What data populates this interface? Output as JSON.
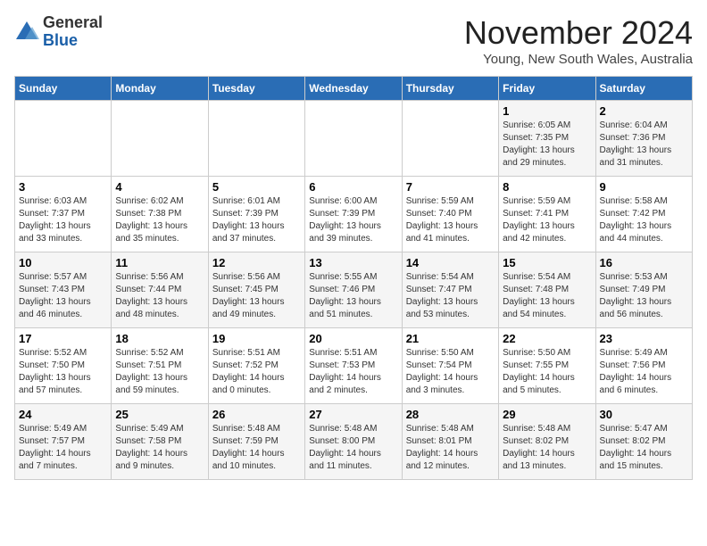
{
  "logo": {
    "general": "General",
    "blue": "Blue"
  },
  "title": "November 2024",
  "location": "Young, New South Wales, Australia",
  "weekdays": [
    "Sunday",
    "Monday",
    "Tuesday",
    "Wednesday",
    "Thursday",
    "Friday",
    "Saturday"
  ],
  "weeks": [
    [
      {
        "day": "",
        "info": ""
      },
      {
        "day": "",
        "info": ""
      },
      {
        "day": "",
        "info": ""
      },
      {
        "day": "",
        "info": ""
      },
      {
        "day": "",
        "info": ""
      },
      {
        "day": "1",
        "info": "Sunrise: 6:05 AM\nSunset: 7:35 PM\nDaylight: 13 hours\nand 29 minutes."
      },
      {
        "day": "2",
        "info": "Sunrise: 6:04 AM\nSunset: 7:36 PM\nDaylight: 13 hours\nand 31 minutes."
      }
    ],
    [
      {
        "day": "3",
        "info": "Sunrise: 6:03 AM\nSunset: 7:37 PM\nDaylight: 13 hours\nand 33 minutes."
      },
      {
        "day": "4",
        "info": "Sunrise: 6:02 AM\nSunset: 7:38 PM\nDaylight: 13 hours\nand 35 minutes."
      },
      {
        "day": "5",
        "info": "Sunrise: 6:01 AM\nSunset: 7:39 PM\nDaylight: 13 hours\nand 37 minutes."
      },
      {
        "day": "6",
        "info": "Sunrise: 6:00 AM\nSunset: 7:39 PM\nDaylight: 13 hours\nand 39 minutes."
      },
      {
        "day": "7",
        "info": "Sunrise: 5:59 AM\nSunset: 7:40 PM\nDaylight: 13 hours\nand 41 minutes."
      },
      {
        "day": "8",
        "info": "Sunrise: 5:59 AM\nSunset: 7:41 PM\nDaylight: 13 hours\nand 42 minutes."
      },
      {
        "day": "9",
        "info": "Sunrise: 5:58 AM\nSunset: 7:42 PM\nDaylight: 13 hours\nand 44 minutes."
      }
    ],
    [
      {
        "day": "10",
        "info": "Sunrise: 5:57 AM\nSunset: 7:43 PM\nDaylight: 13 hours\nand 46 minutes."
      },
      {
        "day": "11",
        "info": "Sunrise: 5:56 AM\nSunset: 7:44 PM\nDaylight: 13 hours\nand 48 minutes."
      },
      {
        "day": "12",
        "info": "Sunrise: 5:56 AM\nSunset: 7:45 PM\nDaylight: 13 hours\nand 49 minutes."
      },
      {
        "day": "13",
        "info": "Sunrise: 5:55 AM\nSunset: 7:46 PM\nDaylight: 13 hours\nand 51 minutes."
      },
      {
        "day": "14",
        "info": "Sunrise: 5:54 AM\nSunset: 7:47 PM\nDaylight: 13 hours\nand 53 minutes."
      },
      {
        "day": "15",
        "info": "Sunrise: 5:54 AM\nSunset: 7:48 PM\nDaylight: 13 hours\nand 54 minutes."
      },
      {
        "day": "16",
        "info": "Sunrise: 5:53 AM\nSunset: 7:49 PM\nDaylight: 13 hours\nand 56 minutes."
      }
    ],
    [
      {
        "day": "17",
        "info": "Sunrise: 5:52 AM\nSunset: 7:50 PM\nDaylight: 13 hours\nand 57 minutes."
      },
      {
        "day": "18",
        "info": "Sunrise: 5:52 AM\nSunset: 7:51 PM\nDaylight: 13 hours\nand 59 minutes."
      },
      {
        "day": "19",
        "info": "Sunrise: 5:51 AM\nSunset: 7:52 PM\nDaylight: 14 hours\nand 0 minutes."
      },
      {
        "day": "20",
        "info": "Sunrise: 5:51 AM\nSunset: 7:53 PM\nDaylight: 14 hours\nand 2 minutes."
      },
      {
        "day": "21",
        "info": "Sunrise: 5:50 AM\nSunset: 7:54 PM\nDaylight: 14 hours\nand 3 minutes."
      },
      {
        "day": "22",
        "info": "Sunrise: 5:50 AM\nSunset: 7:55 PM\nDaylight: 14 hours\nand 5 minutes."
      },
      {
        "day": "23",
        "info": "Sunrise: 5:49 AM\nSunset: 7:56 PM\nDaylight: 14 hours\nand 6 minutes."
      }
    ],
    [
      {
        "day": "24",
        "info": "Sunrise: 5:49 AM\nSunset: 7:57 PM\nDaylight: 14 hours\nand 7 minutes."
      },
      {
        "day": "25",
        "info": "Sunrise: 5:49 AM\nSunset: 7:58 PM\nDaylight: 14 hours\nand 9 minutes."
      },
      {
        "day": "26",
        "info": "Sunrise: 5:48 AM\nSunset: 7:59 PM\nDaylight: 14 hours\nand 10 minutes."
      },
      {
        "day": "27",
        "info": "Sunrise: 5:48 AM\nSunset: 8:00 PM\nDaylight: 14 hours\nand 11 minutes."
      },
      {
        "day": "28",
        "info": "Sunrise: 5:48 AM\nSunset: 8:01 PM\nDaylight: 14 hours\nand 12 minutes."
      },
      {
        "day": "29",
        "info": "Sunrise: 5:48 AM\nSunset: 8:02 PM\nDaylight: 14 hours\nand 13 minutes."
      },
      {
        "day": "30",
        "info": "Sunrise: 5:47 AM\nSunset: 8:02 PM\nDaylight: 14 hours\nand 15 minutes."
      }
    ]
  ]
}
